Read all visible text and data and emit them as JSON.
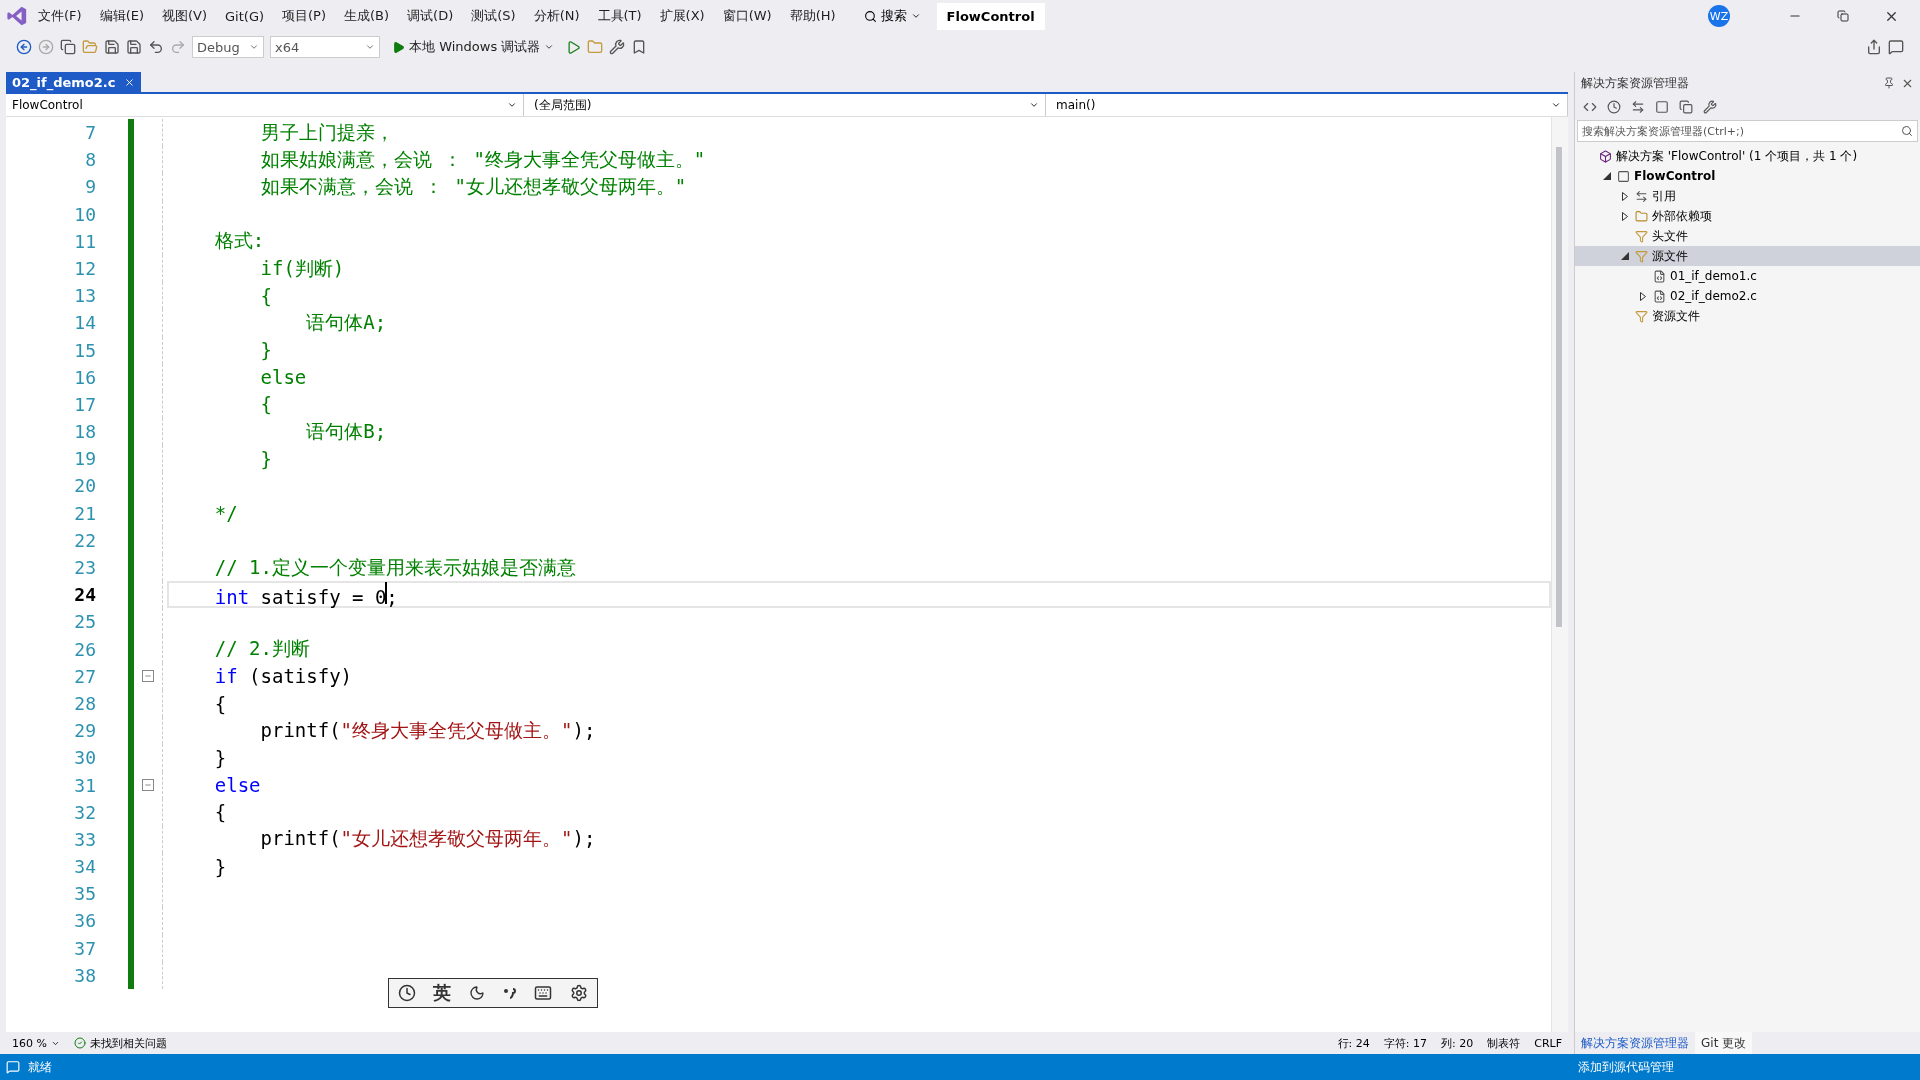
{
  "title_bar": {
    "menu": [
      "文件(F)",
      "编辑(E)",
      "视图(V)",
      "Git(G)",
      "项目(P)",
      "生成(B)",
      "调试(D)",
      "测试(S)",
      "分析(N)",
      "工具(T)",
      "扩展(X)",
      "窗口(W)",
      "帮助(H)"
    ],
    "search": "搜索",
    "solution_name": "FlowControl",
    "avatar": "WZ"
  },
  "toolbar": {
    "configuration": "Debug",
    "platform": "x64",
    "run_label": "本地 Windows 调试器"
  },
  "document_tabs": [
    {
      "label": "02_if_demo2.c",
      "selected": true
    }
  ],
  "navigation_bar": {
    "project": "FlowControl",
    "scope": "(全局范围)",
    "member": "main()"
  },
  "editor": {
    "lines": [
      {
        "number": "7",
        "current": false,
        "fold": false,
        "tokens": [
          {
            "kind": "comment",
            "text": "        男子上门提亲，"
          }
        ]
      },
      {
        "number": "8",
        "current": false,
        "fold": false,
        "tokens": [
          {
            "kind": "comment",
            "text": "        如果姑娘满意，会说 ： \"终身大事全凭父母做主。\""
          }
        ]
      },
      {
        "number": "9",
        "current": false,
        "fold": false,
        "tokens": [
          {
            "kind": "comment",
            "text": "        如果不满意，会说 ： \"女儿还想孝敬父母两年。\""
          }
        ]
      },
      {
        "number": "10",
        "current": false,
        "fold": false
      },
      {
        "number": "11",
        "current": false,
        "fold": false,
        "tokens": [
          {
            "kind": "comment",
            "text": "    格式:"
          }
        ]
      },
      {
        "number": "12",
        "current": false,
        "fold": false,
        "tokens": [
          {
            "kind": "comment",
            "text": "        if(判断)"
          }
        ]
      },
      {
        "number": "13",
        "current": false,
        "fold": false,
        "tokens": [
          {
            "kind": "comment",
            "text": "        {"
          }
        ]
      },
      {
        "number": "14",
        "current": false,
        "fold": false,
        "tokens": [
          {
            "kind": "comment",
            "text": "            语句体A;"
          }
        ]
      },
      {
        "number": "15",
        "current": false,
        "fold": false,
        "tokens": [
          {
            "kind": "comment",
            "text": "        }"
          }
        ]
      },
      {
        "number": "16",
        "current": false,
        "fold": false,
        "tokens": [
          {
            "kind": "comment",
            "text": "        else"
          }
        ]
      },
      {
        "number": "17",
        "current": false,
        "fold": false,
        "tokens": [
          {
            "kind": "comment",
            "text": "        {"
          }
        ]
      },
      {
        "number": "18",
        "current": false,
        "fold": false,
        "tokens": [
          {
            "kind": "comment",
            "text": "            语句体B;"
          }
        ]
      },
      {
        "number": "19",
        "current": false,
        "fold": false,
        "tokens": [
          {
            "kind": "comment",
            "text": "        }"
          }
        ]
      },
      {
        "number": "20",
        "current": false,
        "fold": false
      },
      {
        "number": "21",
        "current": false,
        "fold": false,
        "tokens": [
          {
            "kind": "comment",
            "text": "    */"
          }
        ]
      },
      {
        "number": "22",
        "current": false,
        "fold": false
      },
      {
        "number": "23",
        "current": false,
        "fold": false,
        "tokens": [
          {
            "kind": "comment",
            "text": "    // 1.定义一个变量用来表示姑娘是否满意"
          }
        ]
      },
      {
        "number": "24",
        "current": true,
        "fold": false,
        "tokens": [
          {
            "kind": "keyword",
            "text": "    int"
          },
          {
            "kind": "plain",
            "text": " satisfy = 0;"
          }
        ]
      },
      {
        "number": "25",
        "current": false,
        "fold": false
      },
      {
        "number": "26",
        "current": false,
        "fold": false,
        "tokens": [
          {
            "kind": "comment",
            "text": "    // 2.判断"
          }
        ]
      },
      {
        "number": "27",
        "current": false,
        "fold": true,
        "tokens": [
          {
            "kind": "keyword",
            "text": "    if"
          },
          {
            "kind": "plain",
            "text": " (satisfy)"
          }
        ]
      },
      {
        "number": "28",
        "current": false,
        "fold": false,
        "tokens": [
          {
            "kind": "plain",
            "text": "    {"
          }
        ]
      },
      {
        "number": "29",
        "current": false,
        "fold": false,
        "tokens": [
          {
            "kind": "plain",
            "text": "        printf("
          },
          {
            "kind": "string",
            "text": "\"终身大事全凭父母做主。\""
          },
          {
            "kind": "plain",
            "text": ");"
          }
        ]
      },
      {
        "number": "30",
        "current": false,
        "fold": false,
        "tokens": [
          {
            "kind": "plain",
            "text": "    }"
          }
        ]
      },
      {
        "number": "31",
        "current": false,
        "fold": true,
        "tokens": [
          {
            "kind": "keyword",
            "text": "    else"
          }
        ]
      },
      {
        "number": "32",
        "current": false,
        "fold": false,
        "tokens": [
          {
            "kind": "plain",
            "text": "    {"
          }
        ]
      },
      {
        "number": "33",
        "current": false,
        "fold": false,
        "tokens": [
          {
            "kind": "plain",
            "text": "        printf("
          },
          {
            "kind": "string",
            "text": "\"女儿还想孝敬父母两年。\""
          },
          {
            "kind": "plain",
            "text": ");"
          }
        ]
      },
      {
        "number": "34",
        "current": false,
        "fold": false,
        "tokens": [
          {
            "kind": "plain",
            "text": "    }"
          }
        ]
      },
      {
        "number": "35",
        "current": false,
        "fold": false
      },
      {
        "number": "36",
        "current": false,
        "fold": false
      },
      {
        "number": "37",
        "current": false,
        "fold": false
      },
      {
        "number": "38",
        "current": false,
        "fold": false
      }
    ]
  },
  "editor_status": {
    "zoom": "160 %",
    "issues": "未找到相关问题",
    "line": "行: 24",
    "char": "字符: 17",
    "col": "列: 20",
    "indent": "制表符",
    "eol": "CRLF"
  },
  "ime_bar": {
    "mode": "英"
  },
  "solution_explorer": {
    "title": "解决方案资源管理器",
    "search_placeholder": "搜索解决方案资源管理器(Ctrl+;)",
    "tree": [
      {
        "label": "解决方案 'FlowControl' (1 个项目，共 1 个)",
        "kind": "solution",
        "expandable": false,
        "selected": false,
        "children": [
          {
            "label": "FlowControl",
            "kind": "project",
            "expandable": true,
            "expanded": true,
            "selected": false,
            "children": [
              {
                "label": "引用",
                "kind": "references",
                "expandable": true,
                "expanded": false,
                "selected": false
              },
              {
                "label": "外部依赖项",
                "kind": "dependencies",
                "expandable": true,
                "expanded": false,
                "selected": false
              },
              {
                "label": "头文件",
                "kind": "filter",
                "expandable": false,
                "selected": false
              },
              {
                "label": "源文件",
                "kind": "filter",
                "expandable": true,
                "expanded": true,
                "selected": true,
                "children": [
                  {
                    "label": "01_if_demo1.c",
                    "kind": "file",
                    "expandable": false,
                    "selected": false
                  },
                  {
                    "label": "02_if_demo2.c",
                    "kind": "file",
                    "expandable": true,
                    "expanded": false,
                    "selected": false
                  }
                ]
              },
              {
                "label": "资源文件",
                "kind": "filter",
                "expandable": false,
                "selected": false
              }
            ]
          }
        ]
      }
    ],
    "bottom_tabs": [
      {
        "label": "解决方案资源管理器",
        "selected": true
      },
      {
        "label": "Git 更改",
        "selected": false
      }
    ]
  },
  "status_bar": {
    "text": "就绪",
    "source_control": "添加到源代码管理"
  }
}
